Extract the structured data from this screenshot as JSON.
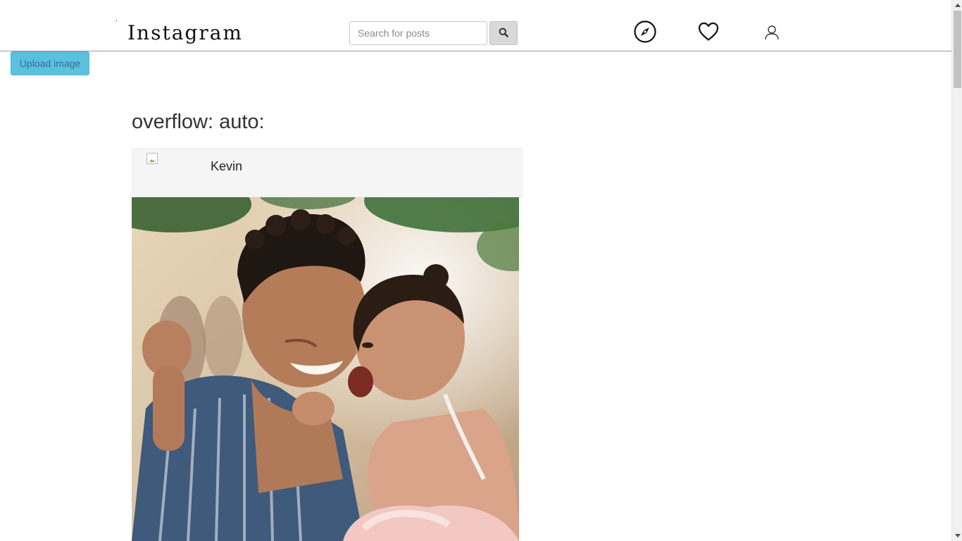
{
  "header": {
    "logo": "Instagram",
    "search": {
      "placeholder": "Search for posts",
      "value": ""
    },
    "icons": [
      "search-icon",
      "compass-icon",
      "heart-icon",
      "user-icon"
    ]
  },
  "toolbar": {
    "upload_label": "Upload image"
  },
  "main": {
    "section_title": "overflow: auto:",
    "posts": [
      {
        "username": "Kevin",
        "avatar": "broken-image-icon",
        "image": "photo of a smiling man holding a laughing little girl"
      }
    ]
  },
  "colors": {
    "upload_button": "#5bc0de",
    "upload_text": "#31708f",
    "search_button": "#d9d9d9",
    "post_header": "#f5f5f5"
  }
}
